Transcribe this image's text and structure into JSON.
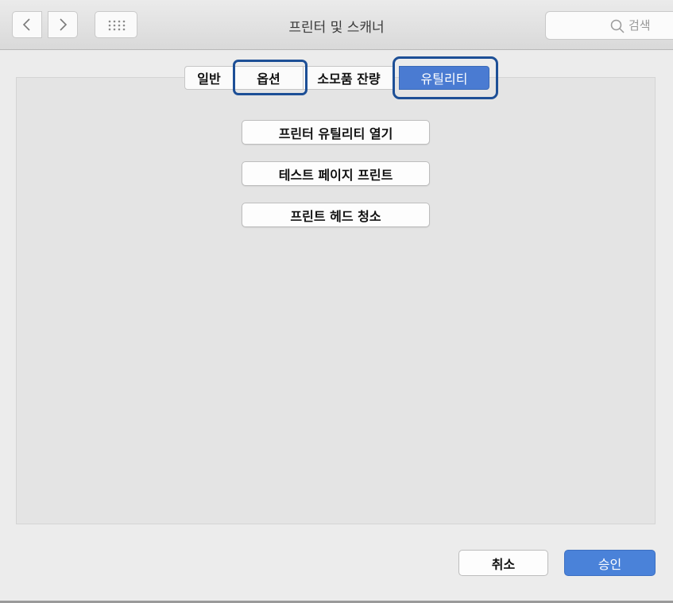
{
  "window": {
    "title": "프린터 및 스캐너"
  },
  "toolbar": {
    "back_icon": "chevron-left-icon",
    "forward_icon": "chevron-right-icon",
    "grid_icon": "grid-icon",
    "search": {
      "placeholder": "검색",
      "icon": "search-icon"
    }
  },
  "tabs": [
    {
      "label": "일반",
      "selected": false
    },
    {
      "label": "옵션",
      "selected": false,
      "highlighted": true
    },
    {
      "label": "소모품 잔량",
      "selected": false
    },
    {
      "label": "유틸리티",
      "selected": true,
      "highlighted": true
    }
  ],
  "utility": {
    "buttons": [
      {
        "label": "프린터 유틸리티 열기"
      },
      {
        "label": "테스트 페이지 프린트"
      },
      {
        "label": "프린트 헤드 청소"
      }
    ]
  },
  "footer": {
    "cancel_label": "취소",
    "approve_label": "승인"
  },
  "colors": {
    "accent": "#4a7bd2",
    "highlight": "#1d4f96"
  }
}
